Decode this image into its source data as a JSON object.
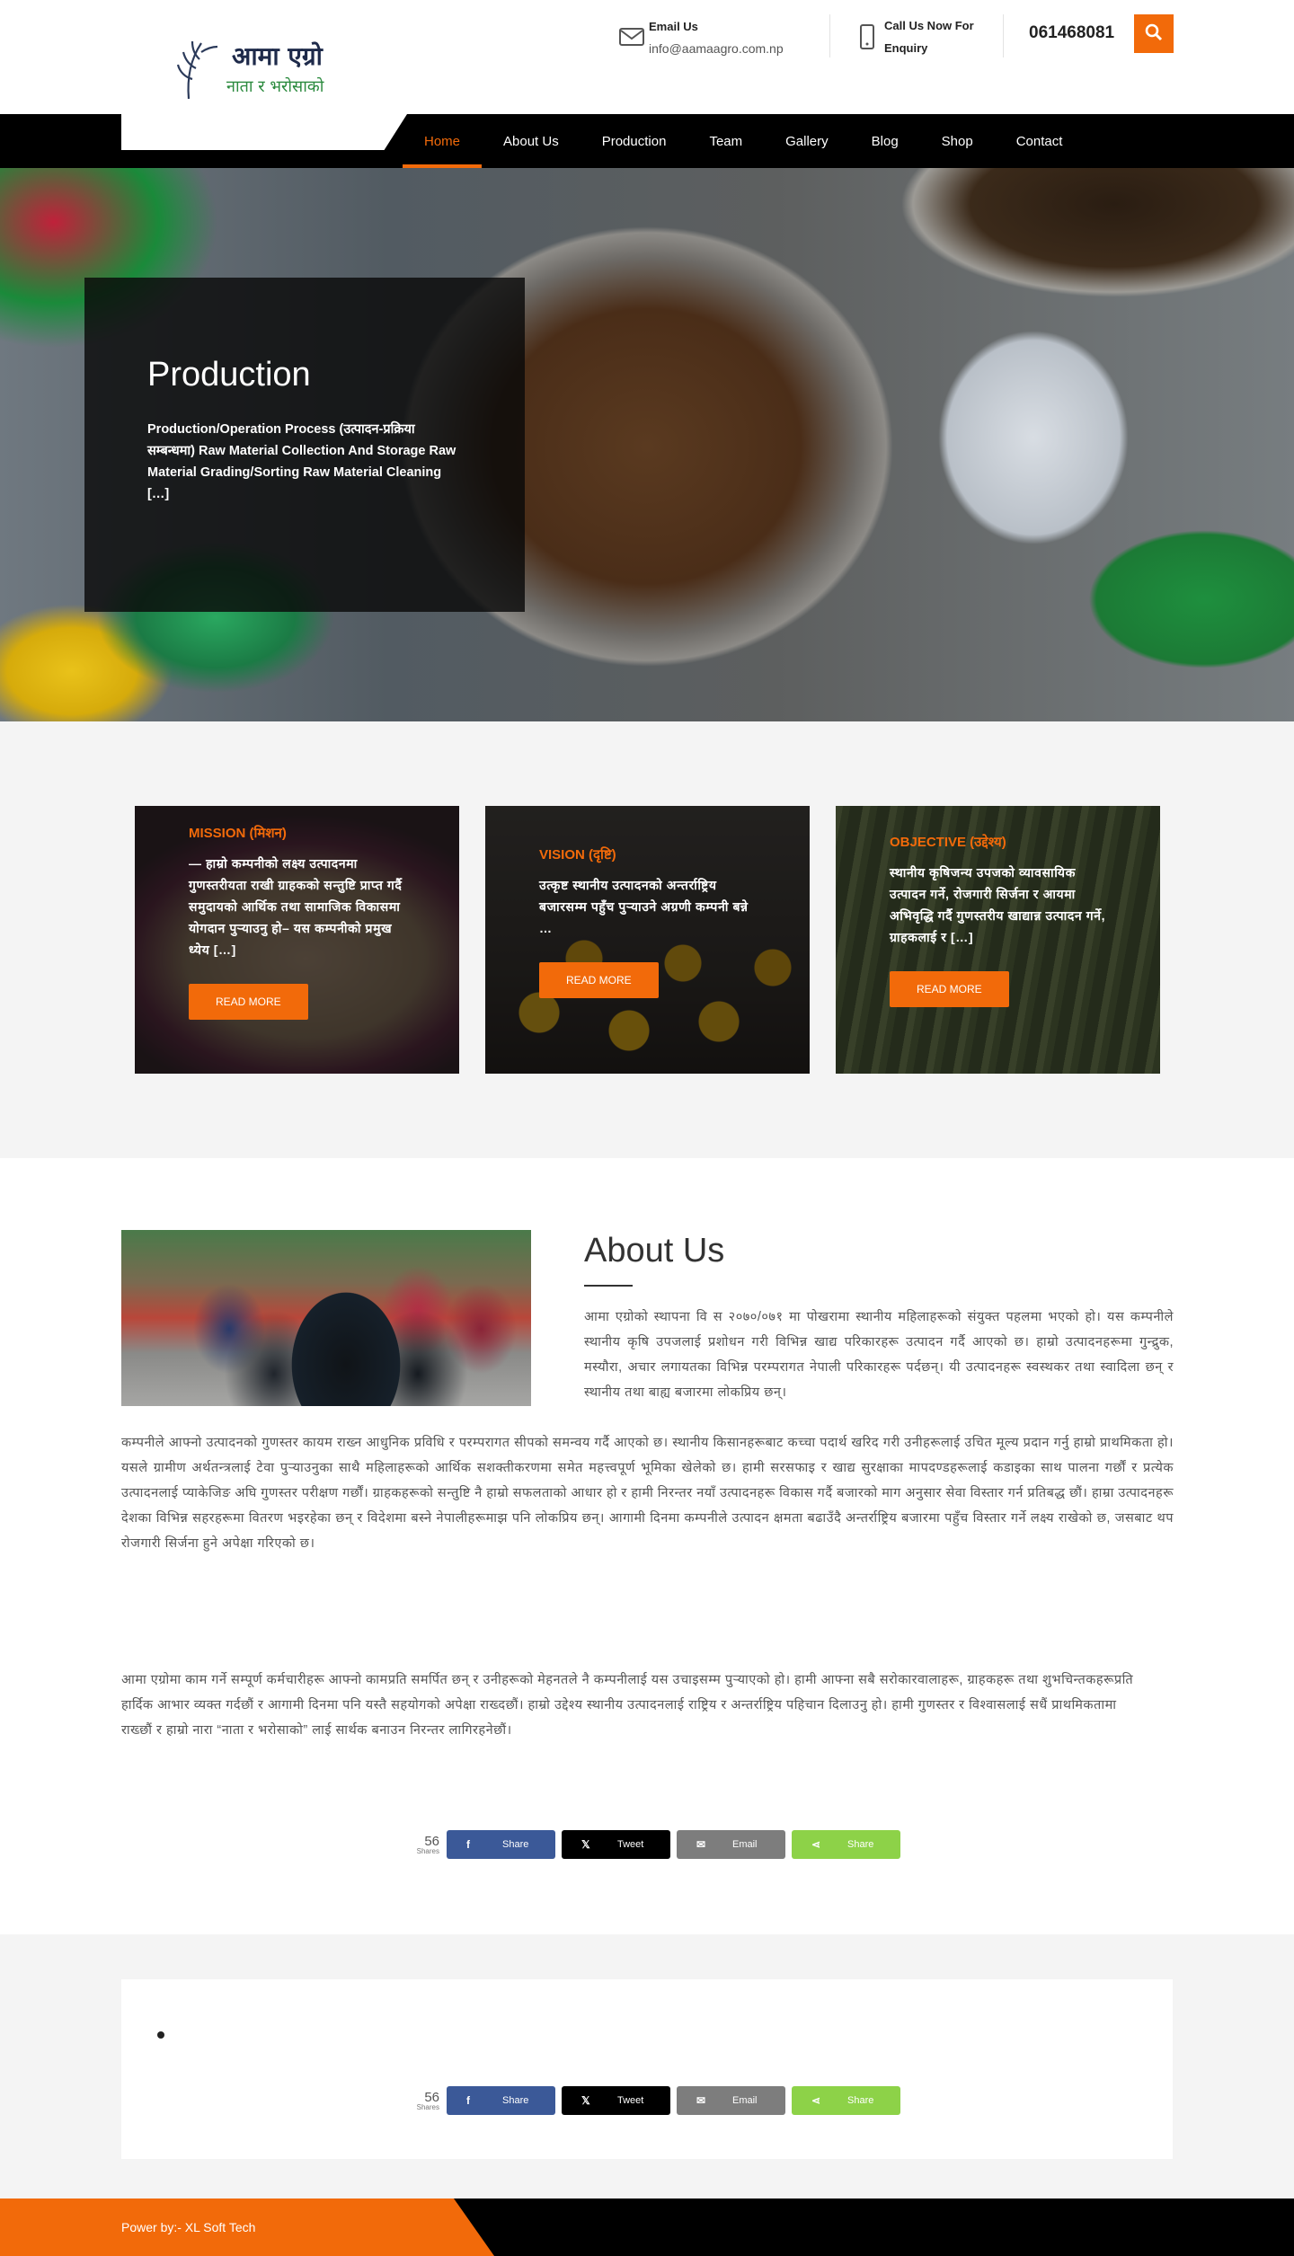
{
  "header": {
    "logo": {
      "line1": "आमा एग्रो",
      "line2": "नाता र भरोसाको",
      "icon": "rice-plant-logo"
    },
    "email": {
      "label": "Email Us",
      "value": "info@aamaagro.com.np",
      "icon": "envelope-icon"
    },
    "call": {
      "label": "Call Us Now For",
      "label2": "Enquiry",
      "icon": "mobile-phone-icon"
    },
    "phone": "061468081",
    "search_icon": "search-icon"
  },
  "nav": {
    "items": [
      {
        "label": "Home",
        "active": true
      },
      {
        "label": "About Us"
      },
      {
        "label": "Production"
      },
      {
        "label": "Team"
      },
      {
        "label": "Gallery"
      },
      {
        "label": "Blog"
      },
      {
        "label": "Shop"
      },
      {
        "label": "Contact"
      }
    ]
  },
  "hero": {
    "title": "Production",
    "text": "Production/Operation Process (उत्पादन-प्रक्रिया सम्बन्धमा) Raw Material Collection And Storage Raw Material Grading/Sorting Raw Material Cleaning […]"
  },
  "cards": [
    {
      "title": "MISSION (मिशन)",
      "text": "— हाम्रो कम्पनीको लक्ष्य उत्पादनमा गुणस्तरीयता राखी ग्राहकको सन्तुष्टि प्राप्त गर्दै समुदायको आर्थिक तथा सामाजिक विकासमा योगदान पुर्‍याउनु हो– यस कम्पनीको प्रमुख ध्येय […]",
      "button": "READ MORE"
    },
    {
      "title": "VISION (दृष्टि)",
      "text": "उत्कृष्ट स्थानीय उत्पादनको अन्तर्राष्ट्रिय बजारसम्म पहुँच पुर्‍याउने अग्रणी कम्पनी बन्ने …",
      "button": "READ MORE"
    },
    {
      "title": "OBJECTIVE (उद्देश्य)",
      "text": "स्थानीय कृषिजन्य उपजको व्यावसायिक उत्पादन गर्ने, रोजगारी सिर्जना र आयमा अभिवृद्धि गर्दै गुणस्तरीय खाद्यान्न उत्पादन गर्ने, ग्राहकलाई र […]",
      "button": "READ MORE"
    }
  ],
  "about": {
    "title": "About Us",
    "p1_side": "आमा एग्रोको स्थापना वि स २०७०/०७१ मा पोखरामा स्थानीय महिलाहरूको संयुक्त पहलमा भएको हो। यस कम्पनीले स्थानीय कृषि उपजलाई प्रशोधन गरी विभिन्न खाद्य परिकारहरू उत्पादन गर्दै आएको छ। हाम्रो उत्पादनहरूमा गुन्द्रुक, मस्यौरा, अचार लगायतका विभिन्न परम्परागत नेपाली परिकारहरू पर्दछन्। यी उत्पादनहरू स्वस्थकर तथा स्वादिला छन् र स्थानीय तथा बाह्य बजारमा लोकप्रिय छन्।",
    "p1_full": "कम्पनीले आफ्नो उत्पादनको गुणस्तर कायम राख्न आधुनिक प्रविधि र परम्परागत सीपको समन्वय गर्दै आएको छ। स्थानीय किसानहरूबाट कच्चा पदार्थ खरिद गरी उनीहरूलाई उचित मूल्य प्रदान गर्नु हाम्रो प्राथमिकता हो। यसले ग्रामीण अर्थतन्त्रलाई टेवा पुर्‍याउनुका साथै महिलाहरूको आर्थिक सशक्तीकरणमा समेत महत्त्वपूर्ण भूमिका खेलेको छ। हामी सरसफाइ र खाद्य सुरक्षाका मापदण्डहरूलाई कडाइका साथ पालना गर्छौं र प्रत्येक उत्पादनलाई प्याकेजिङ अघि गुणस्तर परीक्षण गर्छौं। ग्राहकहरूको सन्तुष्टि नै हाम्रो सफलताको आधार हो र हामी निरन्तर नयाँ उत्पादनहरू विकास गर्दै बजारको माग अनुसार सेवा विस्तार गर्न प्रतिबद्ध छौं। हाम्रा उत्पादनहरू देशका विभिन्न सहरहरूमा वितरण भइरहेका छन् र विदेशमा बस्ने नेपालीहरूमाझ पनि लोकप्रिय छन्। आगामी दिनमा कम्पनीले उत्पादन क्षमता बढाउँदै अन्तर्राष्ट्रिय बजारमा पहुँच विस्तार गर्ने लक्ष्य राखेको छ, जसबाट थप रोजगारी सिर्जना हुने अपेक्षा गरिएको छ।",
    "p2": "आमा एग्रोमा काम गर्ने सम्पूर्ण कर्मचारीहरू आफ्नो कामप्रति समर्पित छन् र उनीहरूको मेहनतले नै कम्पनीलाई यस उचाइसम्म पुर्‍याएको हो। हामी आफ्ना सबै सरोकारवालाहरू, ग्राहकहरू तथा शुभचिन्तकहरूप्रति हार्दिक आभार व्यक्त गर्दछौं र आगामी दिनमा पनि यस्तै सहयोगको अपेक्षा राख्दछौं। हाम्रो उद्देश्य स्थानीय उत्पादनलाई राष्ट्रिय र अन्तर्राष्ट्रिय पहिचान दिलाउनु हो। हामी गुणस्तर र विश्वासलाई सधैं प्राथमिकतामा राख्छौं र हाम्रो नारा “नाता र भरोसाको” लाई सार्थक बनाउन निरन्तर लागिरहनेछौं।"
  },
  "share": {
    "count": "56",
    "count_label": "Shares",
    "buttons": [
      {
        "label": "Share",
        "icon": "facebook-icon",
        "glyph": "f"
      },
      {
        "label": "Tweet",
        "icon": "x-twitter-icon",
        "glyph": "𝕏"
      },
      {
        "label": "Email",
        "icon": "email-icon",
        "glyph": "✉"
      },
      {
        "label": "Share",
        "icon": "share-icon",
        "glyph": "⋖"
      }
    ]
  },
  "footer": {
    "text": "Power by:- XL Soft Tech"
  },
  "colors": {
    "accent": "#f26a0a",
    "nav_bg": "#000000",
    "facebook": "#3b5998",
    "x": "#000000",
    "email": "#7d7d7d",
    "share": "#8dd248"
  }
}
